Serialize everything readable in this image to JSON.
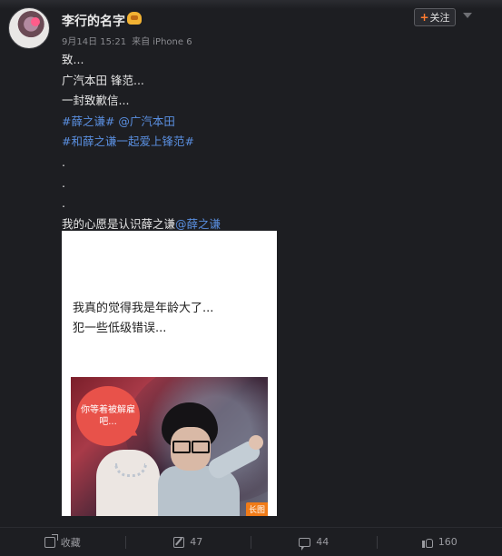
{
  "post": {
    "username": "李行的名字",
    "date": "9月14日 15:21",
    "source": "来自 iPhone 6",
    "follow_label": "关注",
    "follow_plus": "+"
  },
  "content": {
    "lines": [
      "致...",
      "广汽本田 锋范...",
      "一封致歉信...",
      "#薛之谦# @广汽本田",
      "#和薛之谦一起爱上锋范#",
      ".",
      ".",
      ".",
      "我的心愿是认识薛之谦",
      "@薛之谦"
    ]
  },
  "card": {
    "text1": "我真的觉得我是年龄大了...",
    "text2": "犯一些低级错误...",
    "bubble1": "你等着被解雇",
    "bubble2": "吧...",
    "long_label": "长图"
  },
  "actions": {
    "favorite": "收藏",
    "repost_count": "47",
    "comment_count": "44",
    "like_count": "160"
  },
  "colors": {
    "link": "#5a8fe0",
    "background": "#1d1e22",
    "accent": "#ff7b2f"
  }
}
